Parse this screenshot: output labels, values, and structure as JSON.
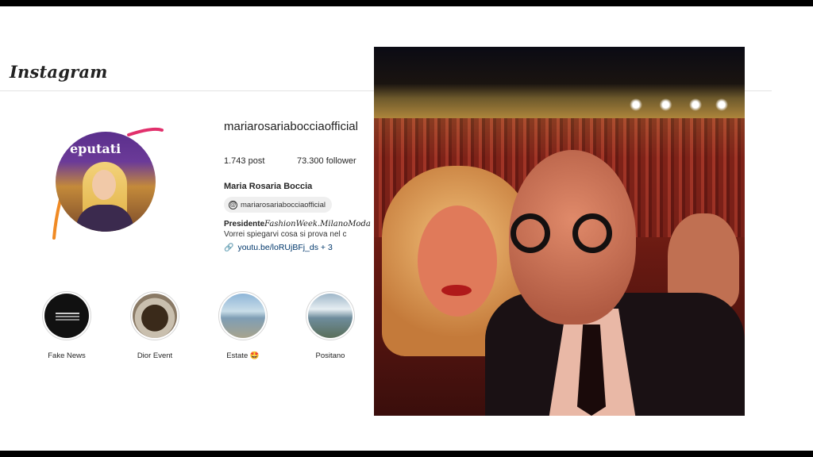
{
  "app": {
    "logo_text": "Instagram"
  },
  "profile": {
    "username": "mariarosariabocciaofficial",
    "posts": "1.743 post",
    "followers": "73.300 follower",
    "full_name": "Maria Rosaria Boccia",
    "threads_handle": "mariarosariabocciaofficial",
    "bio_bold": "Presidente",
    "bio_italic": "FashionWeek.MilanoModa",
    "bio_line2": "Vorrei spiegarvi cosa si prova nel c",
    "link_text": "youtu.be/loRUjBFj_ds + 3",
    "avatar_text": "eputati"
  },
  "highlights": [
    {
      "label": "Fake News"
    },
    {
      "label": "Dior Event"
    },
    {
      "label": "Estate 🤩"
    },
    {
      "label": "Positano"
    }
  ],
  "colors": {
    "story_ring": "#e1306c",
    "link": "#00376b",
    "avatar_bg": "#5a2f8c"
  },
  "icons": {
    "threads": "threads-icon",
    "link": "link-icon"
  }
}
